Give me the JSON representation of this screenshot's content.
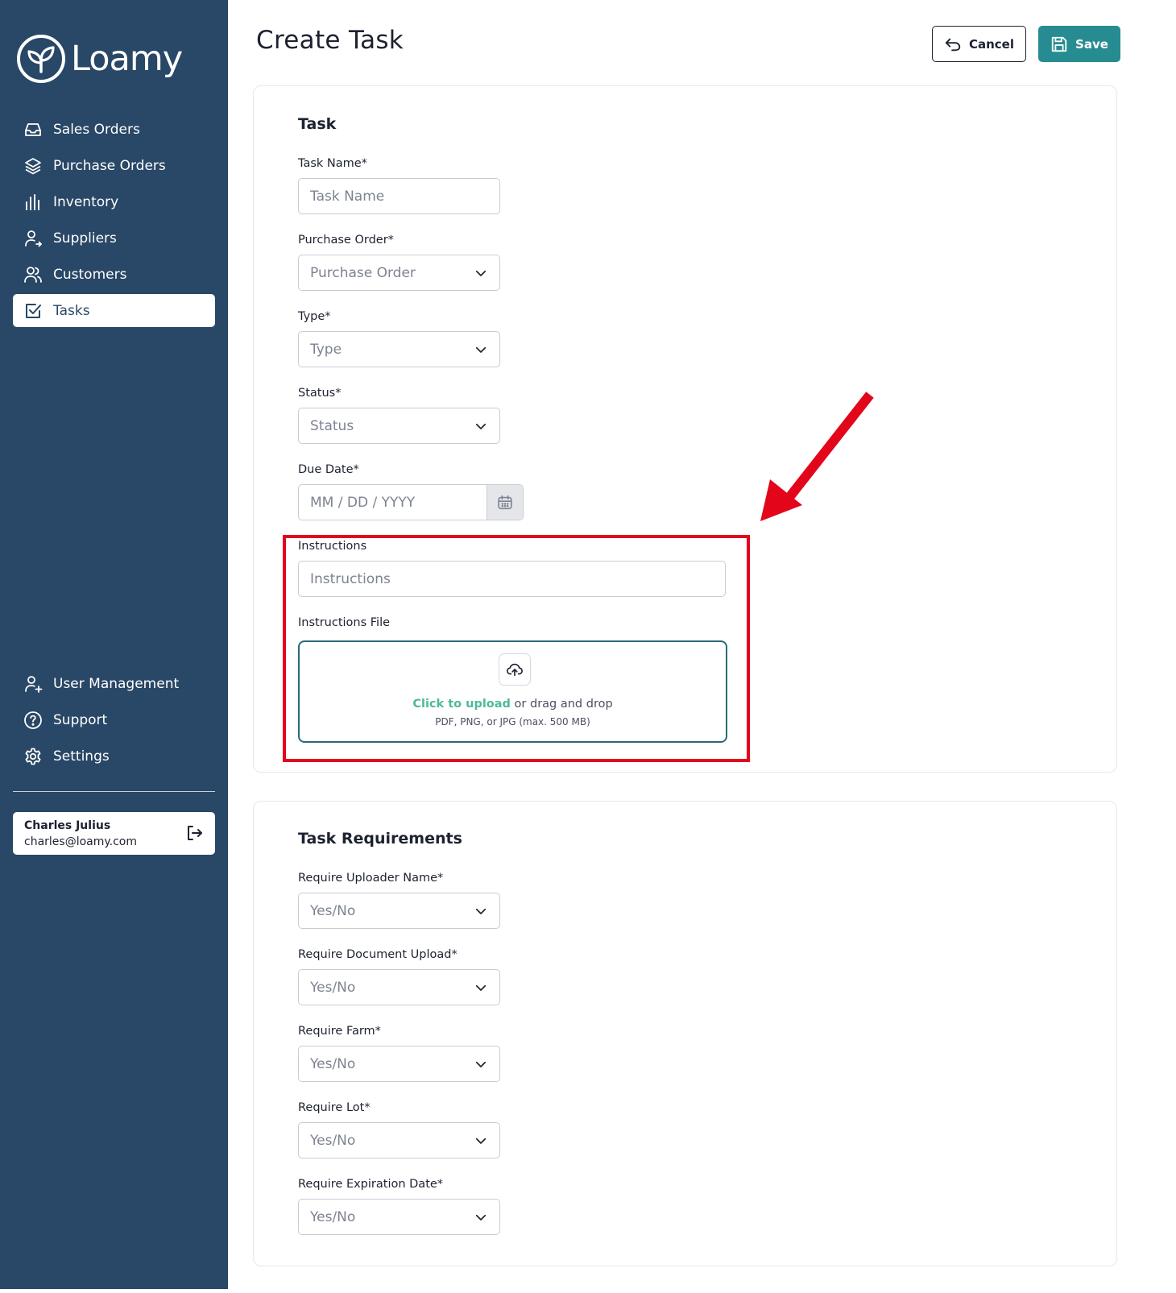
{
  "app": {
    "name": "Loamy"
  },
  "sidebar": {
    "items": [
      {
        "label": "Sales Orders",
        "icon": "inbox-icon"
      },
      {
        "label": "Purchase Orders",
        "icon": "layers-icon"
      },
      {
        "label": "Inventory",
        "icon": "bar-chart-icon"
      },
      {
        "label": "Suppliers",
        "icon": "user-arrow-icon"
      },
      {
        "label": "Customers",
        "icon": "users-icon"
      },
      {
        "label": "Tasks",
        "icon": "checkbox-icon",
        "active": true
      }
    ],
    "bottom_items": [
      {
        "label": "User Management",
        "icon": "user-plus-icon"
      },
      {
        "label": "Support",
        "icon": "help-circle-icon"
      },
      {
        "label": "Settings",
        "icon": "gear-icon"
      }
    ],
    "user": {
      "name": "Charles Julius",
      "email": "charles@loamy.com"
    }
  },
  "header": {
    "title": "Create Task",
    "cancel_label": "Cancel",
    "save_label": "Save"
  },
  "task_section": {
    "title": "Task",
    "task_name": {
      "label": "Task Name*",
      "placeholder": "Task Name"
    },
    "purchase_order": {
      "label": "Purchase Order*",
      "placeholder": "Purchase Order"
    },
    "type": {
      "label": "Type*",
      "placeholder": "Type"
    },
    "status": {
      "label": "Status*",
      "placeholder": "Status"
    },
    "due_date": {
      "label": "Due Date*",
      "placeholder": "MM / DD / YYYY"
    },
    "instructions": {
      "label": "Instructions",
      "placeholder": "Instructions"
    },
    "instructions_file": {
      "label": "Instructions File",
      "click_text": "Click to upload",
      "drag_text": " or drag and drop",
      "hint": "PDF, PNG, or JPG (max. 500 MB)"
    }
  },
  "requirements_section": {
    "title": "Task Requirements",
    "fields": [
      {
        "label": "Require Uploader Name*",
        "placeholder": "Yes/No"
      },
      {
        "label": "Require Document Upload*",
        "placeholder": "Yes/No"
      },
      {
        "label": "Require Farm*",
        "placeholder": "Yes/No"
      },
      {
        "label": "Require Lot*",
        "placeholder": "Yes/No"
      },
      {
        "label": "Require Expiration Date*",
        "placeholder": "Yes/No"
      }
    ]
  },
  "colors": {
    "sidebar_bg": "#294766",
    "accent": "#278c91",
    "upload_link": "#4cba9a",
    "annotation": "#e3061b"
  }
}
